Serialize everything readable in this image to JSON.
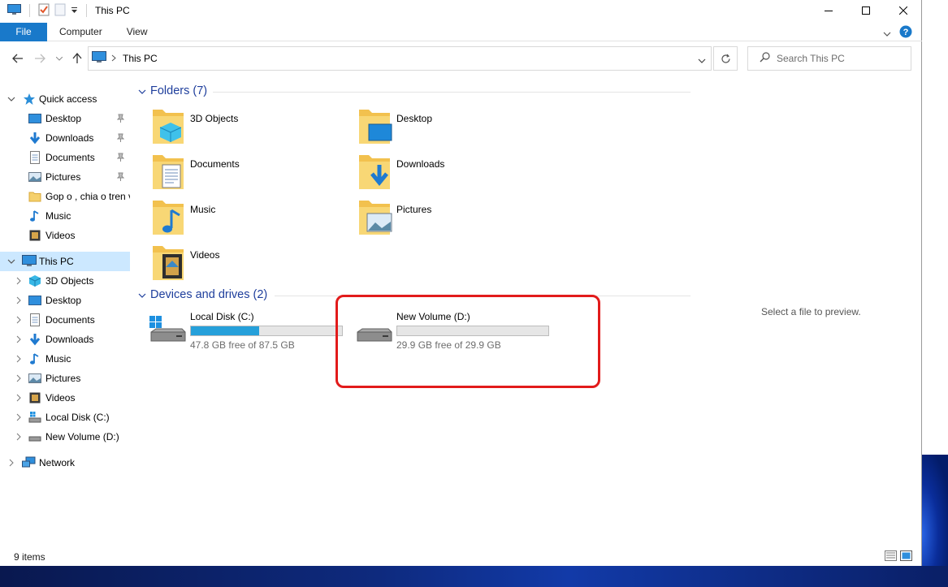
{
  "window": {
    "title": "This PC",
    "colors": {
      "accent": "#1979ca",
      "group_header": "#1e3e9c",
      "selection": "#cce8ff",
      "highlight": "#e21b1b",
      "bar_fill": "#26a0da"
    }
  },
  "ribbon": {
    "tabs": [
      "File",
      "Computer",
      "View"
    ]
  },
  "address": {
    "breadcrumb": "This PC",
    "search_placeholder": "Search This PC"
  },
  "nav": {
    "quick_access": "Quick access",
    "quick_items": [
      {
        "label": "Desktop",
        "icon": "desktop-icon",
        "pinned": true
      },
      {
        "label": "Downloads",
        "icon": "downloads-icon",
        "pinned": true
      },
      {
        "label": "Documents",
        "icon": "documents-icon",
        "pinned": true
      },
      {
        "label": "Pictures",
        "icon": "pictures-icon",
        "pinned": true
      },
      {
        "label": "Gop o , chia o tren v",
        "icon": "folder-icon",
        "pinned": false
      },
      {
        "label": "Music",
        "icon": "music-icon",
        "pinned": false
      },
      {
        "label": "Videos",
        "icon": "videos-icon",
        "pinned": false
      }
    ],
    "this_pc": "This PC",
    "pc_items": [
      {
        "label": "3D Objects",
        "icon": "3d-objects-icon"
      },
      {
        "label": "Desktop",
        "icon": "desktop-icon"
      },
      {
        "label": "Documents",
        "icon": "documents-icon"
      },
      {
        "label": "Downloads",
        "icon": "downloads-icon"
      },
      {
        "label": "Music",
        "icon": "music-icon"
      },
      {
        "label": "Pictures",
        "icon": "pictures-icon"
      },
      {
        "label": "Videos",
        "icon": "videos-icon"
      },
      {
        "label": "Local Disk (C:)",
        "icon": "local-disk-icon"
      },
      {
        "label": "New Volume (D:)",
        "icon": "drive-icon"
      }
    ],
    "network": "Network"
  },
  "content": {
    "folders_header": "Folders (7)",
    "folders": [
      {
        "name": "3D Objects",
        "icon": "3d-objects-folder-icon"
      },
      {
        "name": "Desktop",
        "icon": "desktop-folder-icon"
      },
      {
        "name": "Documents",
        "icon": "documents-folder-icon"
      },
      {
        "name": "Downloads",
        "icon": "downloads-folder-icon"
      },
      {
        "name": "Music",
        "icon": "music-folder-icon"
      },
      {
        "name": "Pictures",
        "icon": "pictures-folder-icon"
      },
      {
        "name": "Videos",
        "icon": "videos-folder-icon"
      }
    ],
    "drives_header": "Devices and drives (2)",
    "drives": [
      {
        "name": "Local Disk (C:)",
        "free": "47.8 GB free of 87.5 GB",
        "used_fraction": 0.454,
        "icon": "windows-drive-icon"
      },
      {
        "name": "New Volume (D:)",
        "free": "29.9 GB free of 29.9 GB",
        "used_fraction": 0.0,
        "icon": "drive-icon"
      }
    ],
    "preview_text": "Select a file to preview."
  },
  "status": {
    "items": "9 items"
  }
}
